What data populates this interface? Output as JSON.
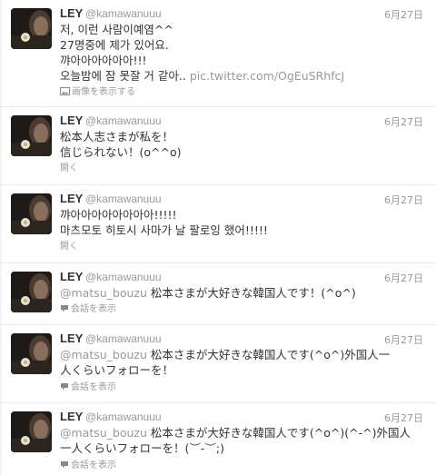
{
  "tweets": [
    {
      "name": "LEY",
      "handle": "@kamawanuuu",
      "time": "6月27日",
      "lines": [
        "저, 이런 사람이예염^^",
        "27명중에 제가 있어요.",
        "꺄아아아아아아!!!"
      ],
      "last_line_text": "오늘밤에 잠 못잘 거 같아..",
      "link": "pic.twitter.com/OgEuSRhfcJ",
      "action": "画像を表示する",
      "action_icon": "image-icon"
    },
    {
      "name": "LEY",
      "handle": "@kamawanuuu",
      "time": "6月27日",
      "lines": [
        "松本人志さまが私を！",
        "信じられない！(o^^o)"
      ],
      "action": "開く"
    },
    {
      "name": "LEY",
      "handle": "@kamawanuuu",
      "time": "6月27日",
      "lines": [
        "꺄아아아아아아아아!!!!!",
        "마츠모토 히토시 사마가 날 팔로잉 했어!!!!!"
      ],
      "action": "開く"
    },
    {
      "name": "LEY",
      "handle": "@kamawanuuu",
      "time": "6月27日",
      "mention": "@matsu_bouzu",
      "lines": [
        " 松本さまが大好きな韓国人です！(^o^)"
      ],
      "action": "会話を表示",
      "action_icon": "conversation-icon"
    },
    {
      "name": "LEY",
      "handle": "@kamawanuuu",
      "time": "6月27日",
      "mention": "@matsu_bouzu",
      "lines": [
        " 松本さまが大好きな韓国人です(^o^)外国人一",
        "人くらいフォローを！"
      ],
      "action": "会話を表示",
      "action_icon": "conversation-icon"
    },
    {
      "name": "LEY",
      "handle": "@kamawanuuu",
      "time": "6月27日",
      "mention": "@matsu_bouzu",
      "lines": [
        " 松本さまが大好きな韓国人です(^o^)(^-^)外国人",
        "一人くらいフォローを！(︶-︶;)"
      ],
      "action": "会話を表示",
      "action_icon": "conversation-icon"
    }
  ]
}
